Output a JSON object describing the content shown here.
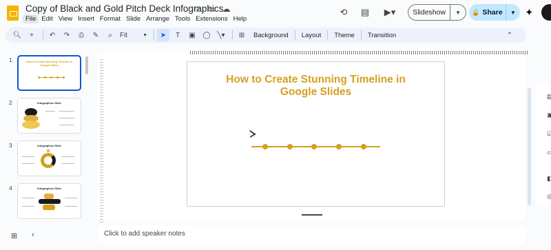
{
  "doc": {
    "title": "Copy of Black and Gold Pitch Deck Infographics"
  },
  "menu": [
    "File",
    "Edit",
    "View",
    "Insert",
    "Format",
    "Slide",
    "Arrange",
    "Tools",
    "Extensions",
    "Help"
  ],
  "header": {
    "slideshow_label": "Slideshow",
    "share_label": "Share"
  },
  "toolbar": {
    "zoom_label": "Fit",
    "background_label": "Background",
    "layout_label": "Layout",
    "theme_label": "Theme",
    "transition_label": "Transition"
  },
  "filmstrip": {
    "slides": [
      {
        "number": "1",
        "title": "How to Create Stunning Timeline in Google Slides"
      },
      {
        "number": "2",
        "title": "Infographics Slide"
      },
      {
        "number": "3",
        "title": "Infographics Slide"
      },
      {
        "number": "4",
        "title": "Infographics Slide"
      }
    ]
  },
  "slide": {
    "title_line1": "How to Create Stunning Timeline in",
    "title_line2": "Google Slides",
    "accent_color": "#d4a020",
    "timeline_points": 5
  },
  "notes": {
    "placeholder": "Click to add speaker notes"
  },
  "icons": {
    "star": "star-icon",
    "move": "move-to-folder-icon",
    "cloud": "cloud-status-icon",
    "history": "version-history-icon",
    "comment": "comments-icon",
    "meet": "meet-icon",
    "lock": "lock-icon",
    "gemini": "gemini-icon"
  }
}
